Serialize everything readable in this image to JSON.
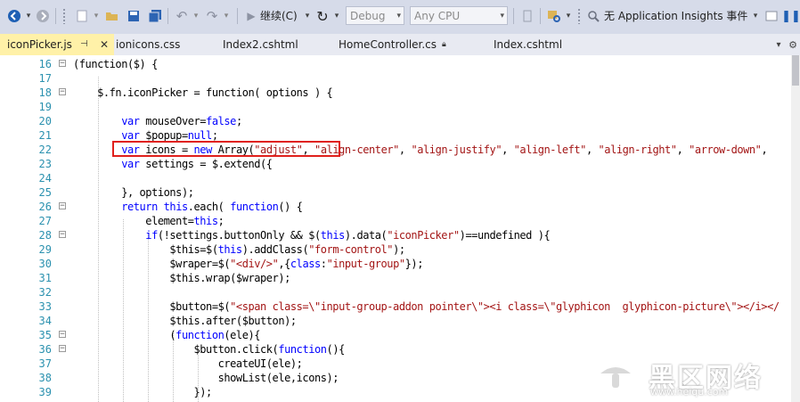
{
  "toolbar": {
    "continue_label": "继续(C)",
    "config_combo": "Debug",
    "platform_combo": "Any CPU",
    "insights_label": "无 Application Insights 事件"
  },
  "tabs": [
    {
      "label": "iconPicker.js",
      "active": true
    },
    {
      "label": "ionicons.css"
    },
    {
      "label": "Index2.cshtml"
    },
    {
      "label": "HomeController.cs"
    },
    {
      "label": "Index.cshtml"
    }
  ],
  "lines": [
    {
      "n": "16",
      "tokens": [
        [
          "d",
          "(function($) {"
        ]
      ]
    },
    {
      "n": "17",
      "tokens": []
    },
    {
      "n": "18",
      "tokens": [
        [
          "d",
          "    $.fn.iconPicker = function( options ) {"
        ]
      ]
    },
    {
      "n": "19",
      "tokens": []
    },
    {
      "n": "20",
      "tokens": [
        [
          "d",
          "        "
        ],
        [
          "k",
          "var"
        ],
        [
          "d",
          " mouseOver="
        ],
        [
          "k",
          "false"
        ],
        [
          "d",
          ";"
        ]
      ]
    },
    {
      "n": "21",
      "tokens": [
        [
          "d",
          "        "
        ],
        [
          "k",
          "var"
        ],
        [
          "d",
          " $popup="
        ],
        [
          "k",
          "null"
        ],
        [
          "d",
          ";"
        ]
      ]
    },
    {
      "n": "22",
      "tokens": [
        [
          "d",
          "        "
        ],
        [
          "k",
          "var"
        ],
        [
          "d",
          " icons = "
        ],
        [
          "k",
          "new"
        ],
        [
          "d",
          " Array("
        ],
        [
          "s",
          "\"adjust\""
        ],
        [
          "d",
          ", "
        ],
        [
          "s",
          "\"align-center\""
        ],
        [
          "d",
          ", "
        ],
        [
          "s",
          "\"align-justify\""
        ],
        [
          "d",
          ", "
        ],
        [
          "s",
          "\"align-left\""
        ],
        [
          "d",
          ", "
        ],
        [
          "s",
          "\"align-right\""
        ],
        [
          "d",
          ", "
        ],
        [
          "s",
          "\"arrow-down\""
        ],
        [
          "d",
          ","
        ]
      ]
    },
    {
      "n": "23",
      "tokens": [
        [
          "d",
          "        "
        ],
        [
          "k",
          "var"
        ],
        [
          "d",
          " settings = $.extend({"
        ]
      ]
    },
    {
      "n": "24",
      "tokens": []
    },
    {
      "n": "25",
      "tokens": [
        [
          "d",
          "        }, options);"
        ]
      ]
    },
    {
      "n": "26",
      "tokens": [
        [
          "d",
          "        "
        ],
        [
          "k",
          "return"
        ],
        [
          "d",
          " "
        ],
        [
          "k",
          "this"
        ],
        [
          "d",
          ".each( "
        ],
        [
          "k",
          "function"
        ],
        [
          "d",
          "() {"
        ]
      ]
    },
    {
      "n": "27",
      "tokens": [
        [
          "d",
          "            element="
        ],
        [
          "k",
          "this"
        ],
        [
          "d",
          ";"
        ]
      ]
    },
    {
      "n": "28",
      "tokens": [
        [
          "d",
          "            "
        ],
        [
          "k",
          "if"
        ],
        [
          "d",
          "(!settings.buttonOnly && $("
        ],
        [
          "k",
          "this"
        ],
        [
          "d",
          ").data("
        ],
        [
          "s",
          "\"iconPicker\""
        ],
        [
          "d",
          ")==undefined ){"
        ]
      ]
    },
    {
      "n": "29",
      "tokens": [
        [
          "d",
          "                $this=$("
        ],
        [
          "k",
          "this"
        ],
        [
          "d",
          ").addClass("
        ],
        [
          "s",
          "\"form-control\""
        ],
        [
          "d",
          ");"
        ]
      ]
    },
    {
      "n": "30",
      "tokens": [
        [
          "d",
          "                $wraper=$("
        ],
        [
          "s",
          "\"<div/>\""
        ],
        [
          "d",
          ",{"
        ],
        [
          "k",
          "class"
        ],
        [
          "d",
          ":"
        ],
        [
          "s",
          "\"input-group\""
        ],
        [
          "d",
          "});"
        ]
      ]
    },
    {
      "n": "31",
      "tokens": [
        [
          "d",
          "                $this.wrap($wraper);"
        ]
      ]
    },
    {
      "n": "32",
      "tokens": []
    },
    {
      "n": "33",
      "tokens": [
        [
          "d",
          "                $button=$("
        ],
        [
          "s",
          "\"<span class=\\\"input-group-addon pointer\\\"><i class=\\\"glyphicon  glyphicon-picture\\\"></i></"
        ]
      ]
    },
    {
      "n": "34",
      "tokens": [
        [
          "d",
          "                $this.after($button);"
        ]
      ]
    },
    {
      "n": "35",
      "tokens": [
        [
          "d",
          "                ("
        ],
        [
          "k",
          "function"
        ],
        [
          "d",
          "(ele){"
        ]
      ]
    },
    {
      "n": "36",
      "tokens": [
        [
          "d",
          "                    $button.click("
        ],
        [
          "k",
          "function"
        ],
        [
          "d",
          "(){"
        ]
      ]
    },
    {
      "n": "37",
      "tokens": [
        [
          "d",
          "                        createUI(ele);"
        ]
      ]
    },
    {
      "n": "38",
      "tokens": [
        [
          "d",
          "                        showList(ele,icons);"
        ]
      ]
    },
    {
      "n": "39",
      "tokens": [
        [
          "d",
          "                    });"
        ]
      ]
    }
  ],
  "fold_lines": [
    "16",
    "18",
    "26",
    "28",
    "35",
    "36"
  ],
  "watermark": {
    "cn": "黑区网络",
    "url": "www.heiqu.com"
  },
  "colors": {
    "keyword": "#0000ff",
    "string": "#a31515",
    "linenumber": "#2b91af",
    "highlight_box": "#e0201c",
    "active_tab": "#fff1a8"
  }
}
